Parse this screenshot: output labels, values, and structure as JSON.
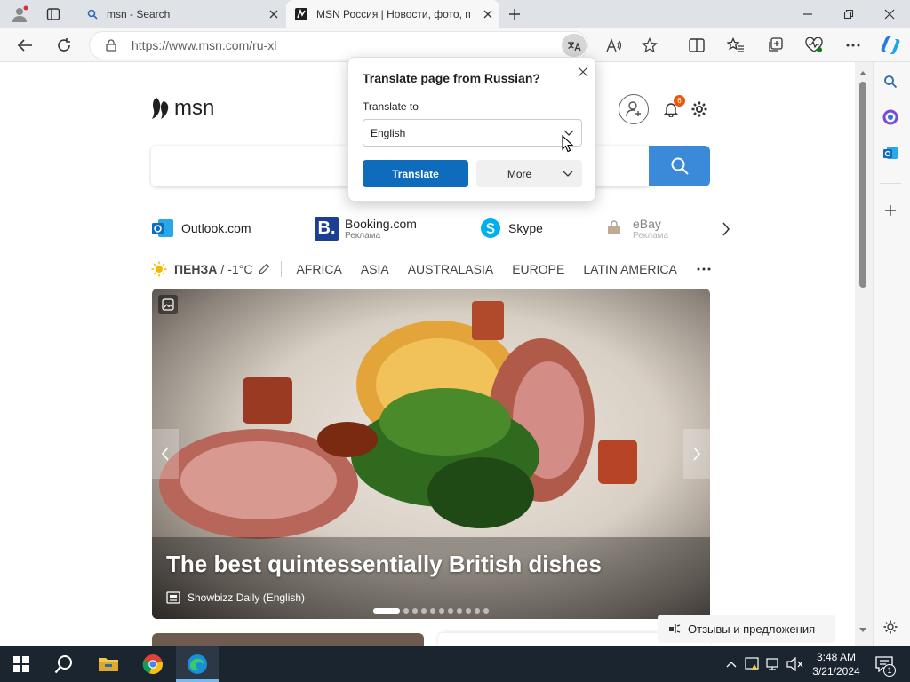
{
  "tabs": [
    {
      "title": "msn - Search"
    },
    {
      "title": "MSN Россия | Новости, фото, п"
    }
  ],
  "address_bar": {
    "url": "https://www.msn.com/ru-xl"
  },
  "msn": {
    "logo_text": "msn",
    "notification_count": "6"
  },
  "quick_links": [
    {
      "label": "Outlook.com",
      "sublabel": ""
    },
    {
      "label": "Booking.com",
      "sublabel": "Реклама"
    },
    {
      "label": "Skype",
      "sublabel": ""
    },
    {
      "label": "eBay",
      "sublabel": "Реклама"
    }
  ],
  "weather": {
    "location": "ПЕНЗА",
    "separator": "/",
    "temp": "-1°C"
  },
  "nav": [
    "AFRICA",
    "ASIA",
    "AUSTRALASIA",
    "EUROPE",
    "LATIN AMERICA"
  ],
  "hero": {
    "headline": "The best quintessentially British dishes",
    "source": "Showbizz Daily (English)",
    "dot_count": 11,
    "active_dot": 0
  },
  "translate_popup": {
    "title": "Translate page from Russian?",
    "label": "Translate to",
    "selected_language": "English",
    "translate_button": "Translate",
    "more_button": "More"
  },
  "feedback": {
    "label": "Отзывы и предложения"
  },
  "taskbar": {
    "time": "3:48 AM",
    "date": "3/21/2024",
    "notifications": "1"
  },
  "colors": {
    "accent": "#0f6cbd",
    "search_button": "#3b8ad9",
    "taskbar": "#1b2530"
  }
}
